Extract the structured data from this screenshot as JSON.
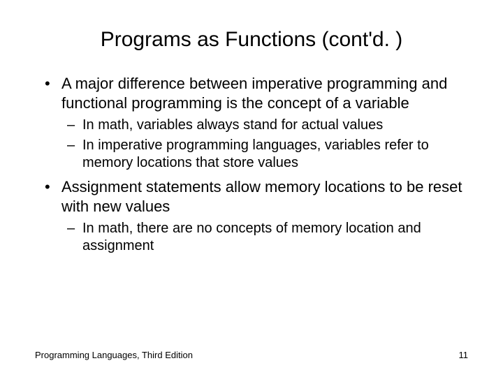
{
  "title": "Programs as Functions (cont'd. )",
  "bullets": [
    {
      "text": "A major difference between imperative programming and functional programming is the concept of a variable",
      "sub": [
        "In math, variables always stand for actual values",
        "In imperative programming languages, variables refer to memory locations that store values"
      ]
    },
    {
      "text": "Assignment statements allow memory locations to be reset with new values",
      "sub": [
        "In math, there are no concepts of memory location and assignment"
      ]
    }
  ],
  "footer": {
    "left": "Programming Languages, Third Edition",
    "right": "11"
  }
}
